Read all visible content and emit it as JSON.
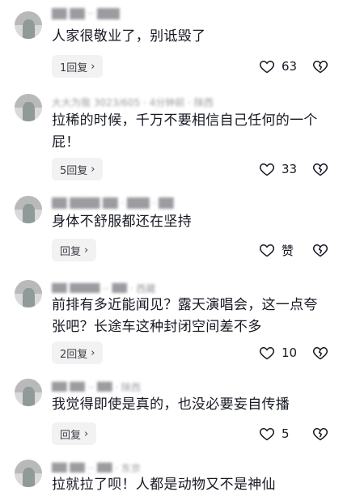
{
  "comments": [
    {
      "meta": "██ ██ ·· ███",
      "text": "人家很敬业了，别诋毁了",
      "reply_label": "1回复",
      "likes": "63"
    },
    {
      "meta": "大大为我 3023/605 · 4分钟前 · 陕西",
      "text": "拉稀的时候，千万不要相信自己任何的一个屁！",
      "reply_label": "5回复",
      "likes": "33"
    },
    {
      "meta": "██ ████ ██ · ███ · ██",
      "text": "身体不舒服都还在坚持",
      "reply_label": "回复",
      "likes": "赞"
    },
    {
      "meta": "██ ████ ·· ██ · 西藏",
      "text": "前排有多近能闻见？露天演唱会，这一点夸张吧？长途车这种封闭空间差不多",
      "reply_label": "2回复",
      "likes": "10"
    },
    {
      "meta": "██ ██ ·· ██ · 陕西",
      "text": "我觉得即使是真的，也没必要妄自传播",
      "reply_label": "回复",
      "likes": "5"
    },
    {
      "meta": "██ ██ ·· ██ · 东京",
      "text": "拉就拉了呗！人都是动物又不是神仙",
      "reply_label": "",
      "likes": ""
    }
  ],
  "icons": {
    "reply_chevron": "chevron-right-icon",
    "like": "heart-icon",
    "dislike": "broken-heart-icon"
  },
  "colors": {
    "text": "#161823",
    "secondary": "#9b9ba0",
    "reply_bg": "#f2f2f3"
  }
}
